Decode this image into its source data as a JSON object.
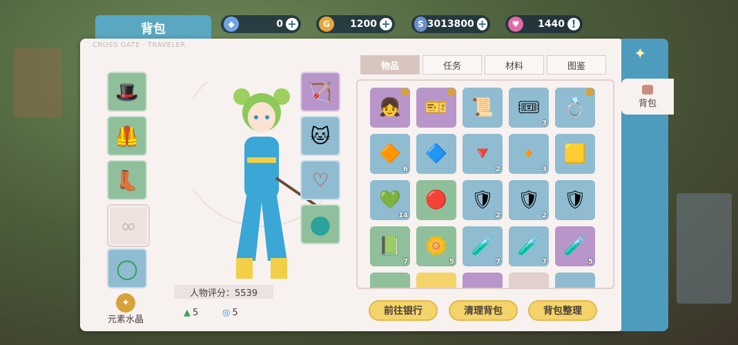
{
  "header": {
    "title": "背包",
    "brand": "CROSS GATE · TRAVELER"
  },
  "currencies": [
    {
      "icon": "diamond-icon",
      "value": "0",
      "plus": "+"
    },
    {
      "icon": "gold-coin-icon",
      "value": "1200",
      "plus": "+"
    },
    {
      "icon": "silver-coin-icon",
      "value": "3013800",
      "plus": "+"
    },
    {
      "icon": "heart-icon",
      "value": "1440",
      "plus": "!"
    }
  ],
  "equipment_left": [
    {
      "name": "hat",
      "glyph": "🎩"
    },
    {
      "name": "armor",
      "glyph": "🦺"
    },
    {
      "name": "boots",
      "glyph": "👢"
    },
    {
      "name": "accessory-empty",
      "glyph": "∞"
    },
    {
      "name": "ring",
      "glyph": "◯"
    }
  ],
  "equipment_right": [
    {
      "name": "bow",
      "glyph": "🏹"
    },
    {
      "name": "pet",
      "glyph": "🐱"
    },
    {
      "name": "necklace",
      "glyph": "♡"
    },
    {
      "name": "orb",
      "glyph": "●"
    }
  ],
  "score": "人物评分：5539",
  "element_label": "元素水晶",
  "stats": [
    {
      "icon": "up-arrow-icon",
      "value": "5"
    },
    {
      "icon": "swirl-icon",
      "value": "5"
    }
  ],
  "tabs": [
    "物品",
    "任务",
    "材料",
    "图鉴"
  ],
  "items": [
    {
      "glyph": "👧",
      "bg": "#b896c9",
      "qty": "",
      "lock": true
    },
    {
      "glyph": "🎫",
      "bg": "#b896c9",
      "qty": "",
      "lock": true
    },
    {
      "glyph": "📜",
      "bg": "#8fbcd0",
      "qty": "",
      "lock": false
    },
    {
      "glyph": "🎟",
      "bg": "#8fbcd0",
      "qty": "3",
      "lock": false
    },
    {
      "glyph": "💍",
      "bg": "#8fbcd0",
      "qty": "",
      "lock": true
    },
    {
      "glyph": "🔶",
      "bg": "#8fbcd0",
      "qty": "6",
      "lock": false
    },
    {
      "glyph": "🔷",
      "bg": "#8fbcd0",
      "qty": "",
      "lock": false
    },
    {
      "glyph": "🔻",
      "bg": "#8fbcd0",
      "qty": "2",
      "lock": false
    },
    {
      "glyph": "🔸",
      "bg": "#8fbcd0",
      "qty": "3",
      "lock": false
    },
    {
      "glyph": "🟨",
      "bg": "#8fbcd0",
      "qty": "",
      "lock": false
    },
    {
      "glyph": "💚",
      "bg": "#8fbcd0",
      "qty": "14",
      "lock": false
    },
    {
      "glyph": "🔴",
      "bg": "#8fbf9b",
      "qty": "",
      "lock": false
    },
    {
      "glyph": "🛡",
      "bg": "#8fbcd0",
      "qty": "2",
      "lock": false
    },
    {
      "glyph": "🛡",
      "bg": "#8fbcd0",
      "qty": "2",
      "lock": false
    },
    {
      "glyph": "🛡",
      "bg": "#8fbcd0",
      "qty": "",
      "lock": false
    },
    {
      "glyph": "📗",
      "bg": "#8fbf9b",
      "qty": "7",
      "lock": false
    },
    {
      "glyph": "🌼",
      "bg": "#8fbf9b",
      "qty": "5",
      "lock": false
    },
    {
      "glyph": "🧪",
      "bg": "#8fbcd0",
      "qty": "7",
      "lock": false
    },
    {
      "glyph": "🧪",
      "bg": "#8fbcd0",
      "qty": "7",
      "lock": false
    },
    {
      "glyph": "🧪",
      "bg": "#b896c9",
      "qty": "5",
      "lock": false
    }
  ],
  "buttons": {
    "bank": "前往银行",
    "clear": "清理背包",
    "sort": "背包整理"
  },
  "side": {
    "tab_label": "背包"
  }
}
